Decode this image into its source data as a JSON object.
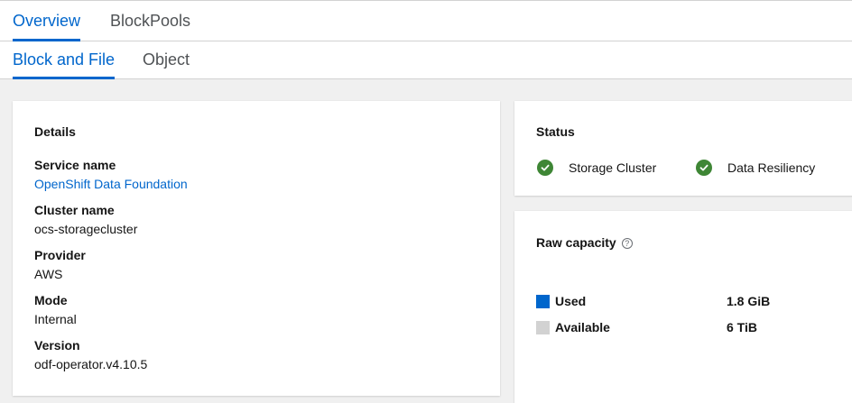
{
  "tabs": [
    {
      "label": "Overview"
    },
    {
      "label": "BlockPools"
    }
  ],
  "subtabs": [
    {
      "label": "Block and File"
    },
    {
      "label": "Object"
    }
  ],
  "details": {
    "title": "Details",
    "service_name_label": "Service name",
    "service_name_value": "OpenShift Data Foundation",
    "cluster_name_label": "Cluster name",
    "cluster_name_value": "ocs-storagecluster",
    "provider_label": "Provider",
    "provider_value": "AWS",
    "mode_label": "Mode",
    "mode_value": "Internal",
    "version_label": "Version",
    "version_value": "odf-operator.v4.10.5"
  },
  "status": {
    "title": "Status",
    "items": [
      {
        "label": "Storage Cluster",
        "state": "healthy"
      },
      {
        "label": "Data Resiliency",
        "state": "healthy"
      }
    ]
  },
  "raw_capacity": {
    "title": "Raw capacity",
    "help_glyph": "?",
    "legend": [
      {
        "label": "Used",
        "value": "1.8 GiB",
        "color": "#0066cc"
      },
      {
        "label": "Available",
        "value": "6 TiB",
        "color": "#d2d2d2"
      }
    ]
  },
  "colors": {
    "accent": "#0066cc",
    "success": "#3e8635",
    "background": "#f0f0f0"
  }
}
